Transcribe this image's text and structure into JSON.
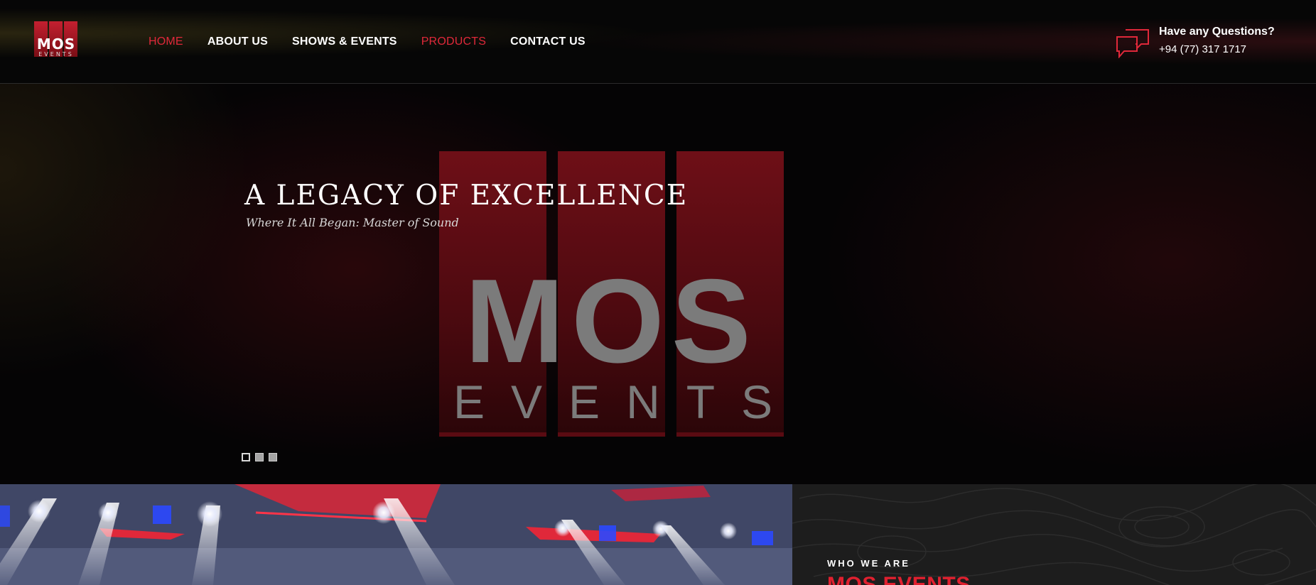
{
  "brand": {
    "logo_word": "MOS",
    "logo_sub": "EVENTS",
    "accent": "#e0283a"
  },
  "nav": {
    "items": [
      {
        "label": "HOME",
        "active": true
      },
      {
        "label": "ABOUT US"
      },
      {
        "label": "SHOWS & EVENTS"
      },
      {
        "label": "PRODUCTS",
        "highlight": true
      },
      {
        "label": "CONTACT US"
      }
    ]
  },
  "contact": {
    "icon": "chat-bubbles-icon",
    "question": "Have any Questions?",
    "phone": "+94 (77) 317 1717"
  },
  "hero": {
    "title": "A LEGACY OF EXCELLENCE",
    "tagline": "Where It All Began: Master of Sound",
    "logo_word": "MOS",
    "logo_sub": "EVENTS",
    "slides": 3,
    "active_slide": 1
  },
  "about": {
    "eyebrow": "WHO WE ARE",
    "title": "MOS EVENTS"
  }
}
